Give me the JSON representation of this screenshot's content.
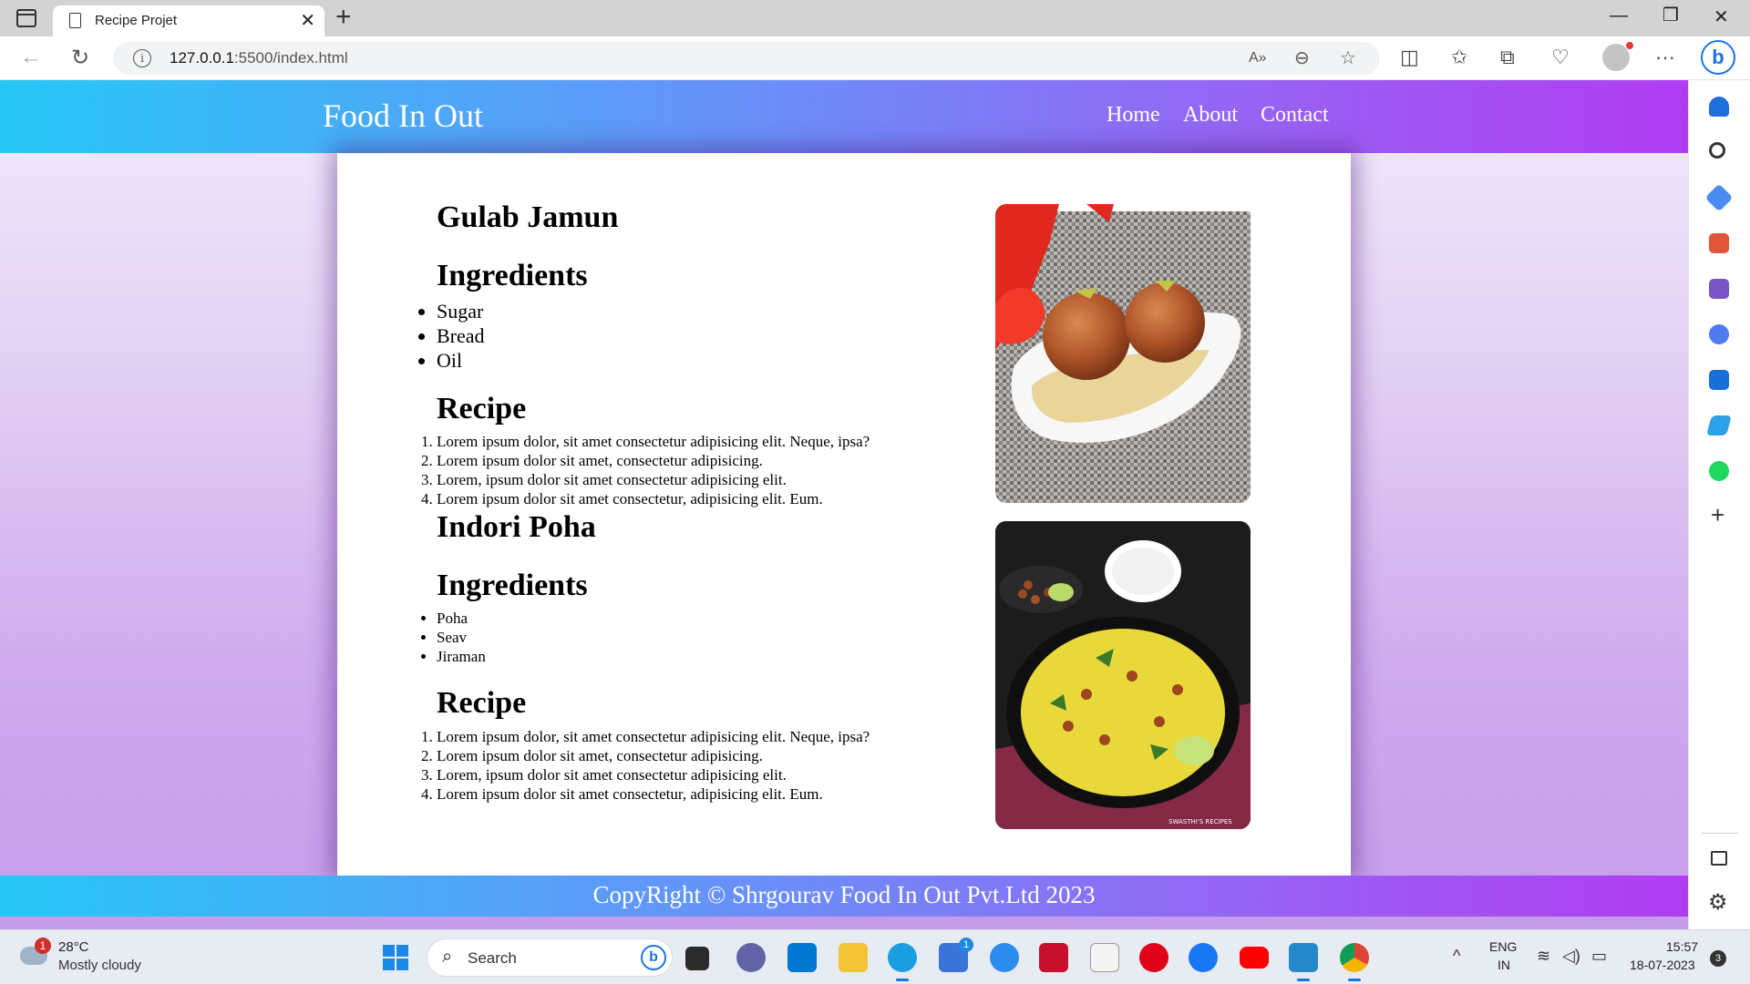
{
  "browser": {
    "tab_title": "Recipe Projet",
    "url_host": "127.0.0.1",
    "url_rest": ":5500/index.html"
  },
  "site": {
    "brand": "Food In Out",
    "nav": [
      "Home",
      "About",
      "Contact"
    ],
    "footer": "CopyRight © Shrgourav Food In Out Pvt.Ltd 2023"
  },
  "recipes": [
    {
      "title": "Gulab Jamun",
      "ingredients_heading": "Ingredients",
      "ingredients": [
        "Sugar",
        "Bread",
        "Oil"
      ],
      "recipe_heading": "Recipe",
      "steps": [
        "Lorem ipsum dolor, sit amet consectetur adipisicing elit. Neque, ipsa?",
        "Lorem ipsum dolor sit amet, consectetur adipisicing.",
        "Lorem, ipsum dolor sit amet consectetur adipisicing elit.",
        "Lorem ipsum dolor sit amet consectetur, adipisicing elit. Eum."
      ]
    },
    {
      "title": "Indori Poha",
      "ingredients_heading": "Ingredients",
      "ingredients": [
        "Poha",
        "Seav",
        "Jiraman"
      ],
      "recipe_heading": "Recipe",
      "steps": [
        "Lorem ipsum dolor, sit amet consectetur adipisicing elit. Neque, ipsa?",
        "Lorem ipsum dolor sit amet, consectetur adipisicing.",
        "Lorem, ipsum dolor sit amet consectetur adipisicing elit.",
        "Lorem ipsum dolor sit amet consectetur, adipisicing elit. Eum."
      ],
      "photo_watermark": "SWASTHI'S RECIPES"
    }
  ],
  "taskbar": {
    "weather_badge": "1",
    "weather_temp": "28°C",
    "weather_desc": "Mostly cloudy",
    "search_placeholder": "Search",
    "store_badge": "1",
    "lang_top": "ENG",
    "lang_bottom": "IN",
    "time": "15:57",
    "date": "18-07-2023",
    "notification_count": "3"
  },
  "colors": {
    "header_gradient_start": "#27c8f6",
    "header_gradient_end": "#b03cf2",
    "page_bg_top": "#f2ecfb",
    "page_bg_bottom": "#c59cea"
  }
}
